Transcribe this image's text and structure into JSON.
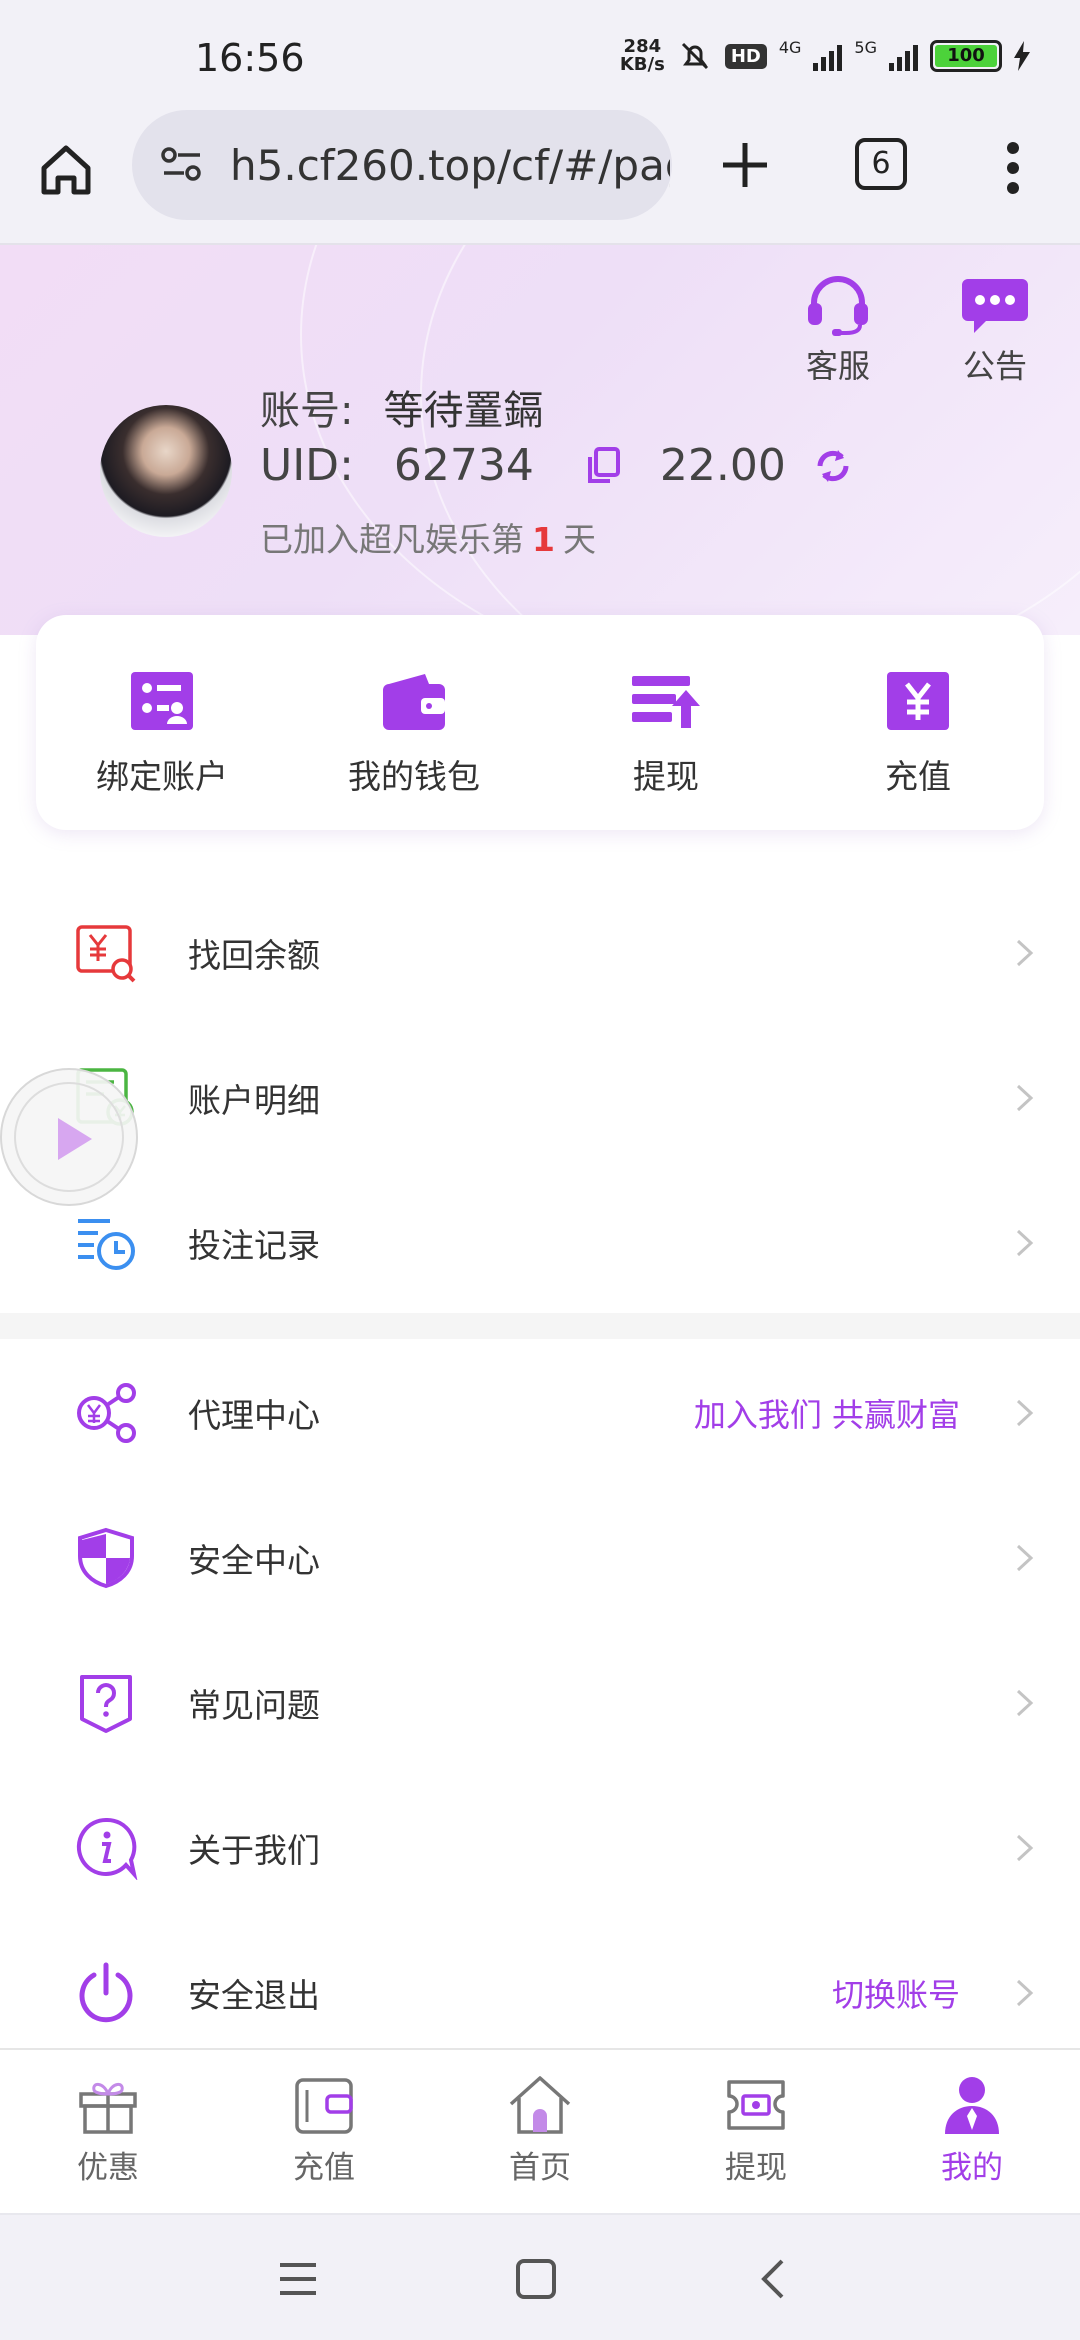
{
  "status_bar": {
    "time": "16:56",
    "net_speed_value": "284",
    "net_speed_unit": "KB/s",
    "hd_label": "HD",
    "sig1_label": "4G",
    "sig2_label": "5G",
    "battery_level": "100"
  },
  "browser": {
    "url": "h5.cf260.top/cf/#/pag",
    "tab_count": "6"
  },
  "header": {
    "service_label": "客服",
    "notice_label": "公告",
    "account_label": "账号:",
    "account_name": "等待罿鎘",
    "uid_label": "UID:",
    "uid_value": "62734",
    "balance": "22.00",
    "joined_prefix": "已加入超凡娱乐第",
    "joined_days": "1",
    "joined_suffix": "天"
  },
  "quick_actions": [
    {
      "label": "绑定账户",
      "icon": "bind-account-icon"
    },
    {
      "label": "我的钱包",
      "icon": "wallet-icon"
    },
    {
      "label": "提现",
      "icon": "withdraw-icon"
    },
    {
      "label": "充值",
      "icon": "recharge-icon"
    }
  ],
  "menu_group1": [
    {
      "label": "找回余额",
      "icon": "recover-balance-icon"
    },
    {
      "label": "账户明细",
      "icon": "account-details-icon"
    },
    {
      "label": "投注记录",
      "icon": "bet-record-icon"
    }
  ],
  "menu_group2": [
    {
      "label": "代理中心",
      "extra": "加入我们 共赢财富",
      "icon": "agent-center-icon"
    },
    {
      "label": "安全中心",
      "extra": "",
      "icon": "security-shield-icon"
    },
    {
      "label": "常见问题",
      "extra": "",
      "icon": "faq-icon"
    },
    {
      "label": "关于我们",
      "extra": "",
      "icon": "about-info-icon"
    },
    {
      "label": "安全退出",
      "extra": "切换账号",
      "icon": "power-icon"
    }
  ],
  "tab_bar": [
    {
      "label": "优惠",
      "icon": "gift-icon"
    },
    {
      "label": "充值",
      "icon": "wallet-icon"
    },
    {
      "label": "首页",
      "icon": "home-icon"
    },
    {
      "label": "提现",
      "icon": "cash-icon"
    },
    {
      "label": "我的",
      "icon": "user-icon",
      "active": true
    }
  ],
  "colors": {
    "accent": "#a23ee8",
    "highlight_red": "#e6393b"
  }
}
